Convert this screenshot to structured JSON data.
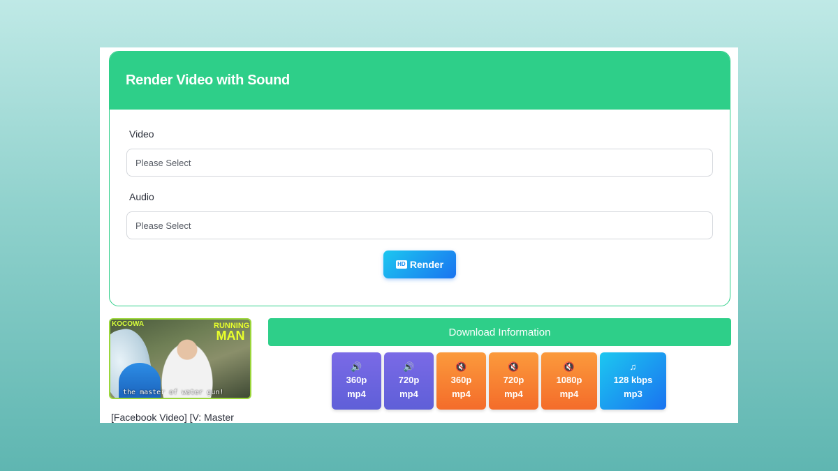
{
  "card": {
    "title": "Render Video with Sound",
    "video_label": "Video",
    "video_placeholder": "Please Select",
    "audio_label": "Audio",
    "audio_placeholder": "Please Select",
    "render_button": "Render",
    "render_icon": "hd-icon"
  },
  "result": {
    "thumbnail": {
      "brand": "KOCOWA",
      "logo_line1": "RUNNING",
      "logo_line2": "MAN",
      "caption": "the master of water gun!"
    },
    "video_title": "[Facebook Video] [V: Master",
    "download_header": "Download Information",
    "formats": [
      {
        "icon": "speaker-icon",
        "quality": "360p",
        "type": "mp4",
        "color": "#6b63de"
      },
      {
        "icon": "speaker-icon",
        "quality": "720p",
        "type": "mp4",
        "color": "#6b63de"
      },
      {
        "icon": "mute-icon",
        "quality": "360p",
        "type": "mp4",
        "color": "#f7862e"
      },
      {
        "icon": "mute-icon",
        "quality": "720p",
        "type": "mp4",
        "color": "#f7862e"
      },
      {
        "icon": "mute-icon",
        "quality": "1080p",
        "type": "mp4",
        "color": "#f7862e"
      },
      {
        "icon": "music-note-icon",
        "quality": "128 kbps",
        "type": "mp3",
        "color": "#1a8ff0"
      }
    ]
  },
  "colors": {
    "accent": "#2ecf89",
    "render_gradient_start": "#1cc7f0",
    "render_gradient_end": "#1a73f0"
  }
}
